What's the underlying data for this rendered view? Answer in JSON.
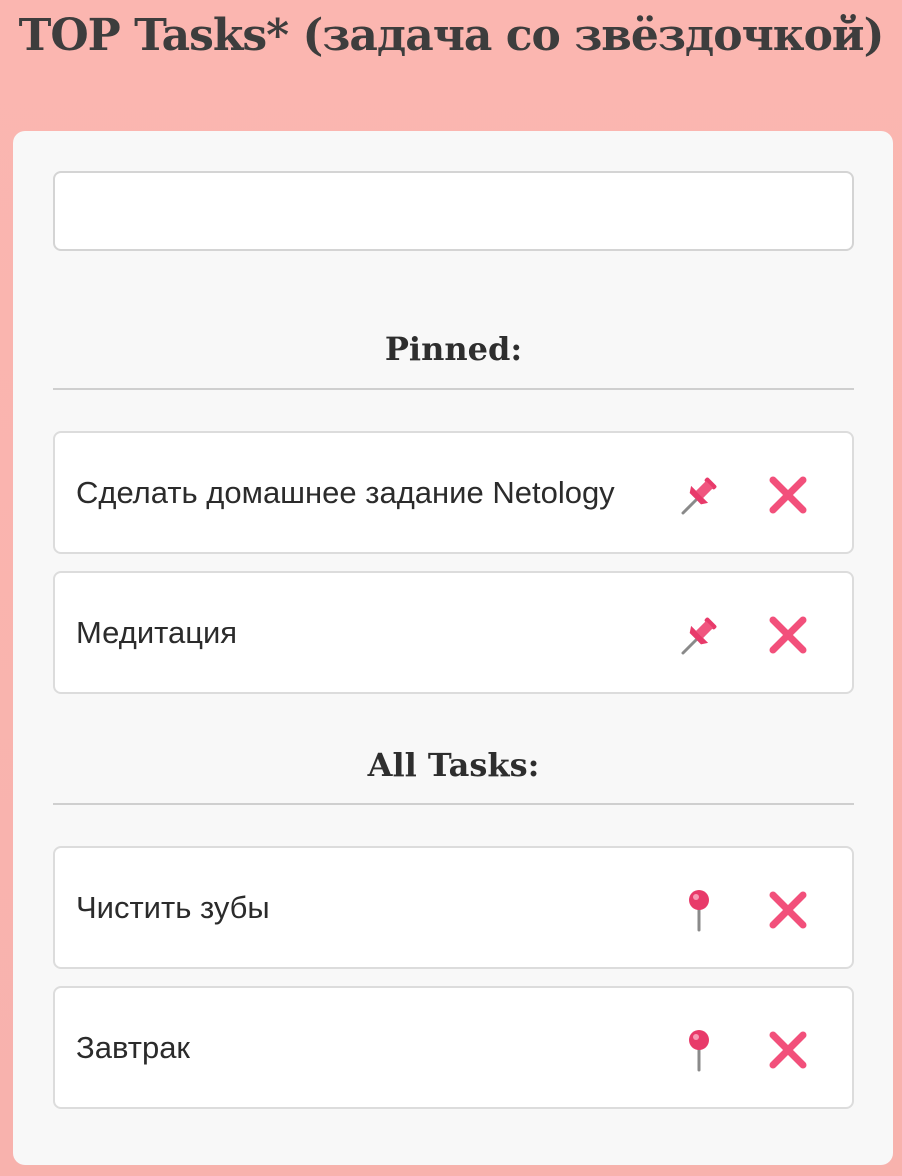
{
  "app": {
    "title": "TOP Tasks* (задача со звёздочкой)"
  },
  "input": {
    "value": "",
    "placeholder": ""
  },
  "pinned": {
    "heading": "Pinned:",
    "tasks": [
      {
        "text": "Сделать домашнее задание Netology",
        "pin_icon": "pushpin-icon",
        "delete_icon": "cross-icon"
      },
      {
        "text": "Медитация",
        "pin_icon": "pushpin-icon",
        "delete_icon": "cross-icon"
      }
    ]
  },
  "all": {
    "heading": "All Tasks:",
    "tasks": [
      {
        "text": "Чистить зубы",
        "pin_icon": "round-pushpin-icon",
        "delete_icon": "cross-icon"
      },
      {
        "text": "Завтрак",
        "pin_icon": "round-pushpin-icon",
        "delete_icon": "cross-icon"
      }
    ]
  },
  "colors": {
    "background": "#fbb6b0",
    "card": "#f8f8f8",
    "accent_pink": "#f2507b",
    "text": "#2b2b2b"
  }
}
